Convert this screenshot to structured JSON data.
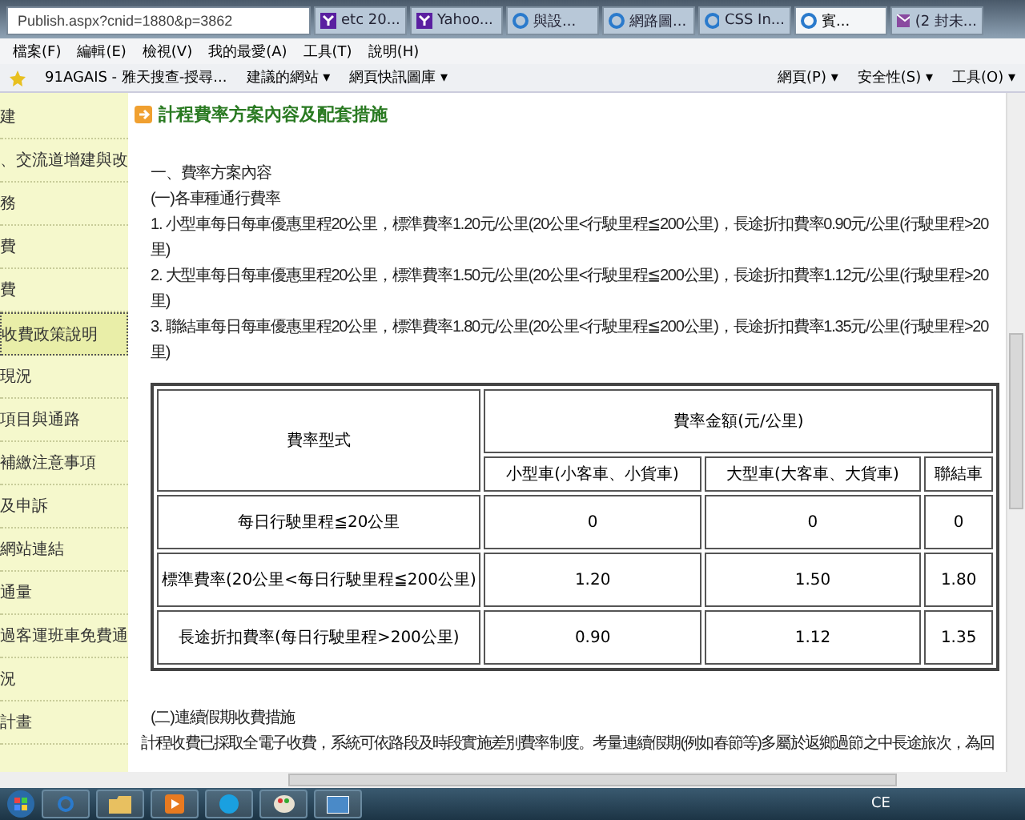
{
  "browser": {
    "address": "Publish.aspx?cnid=1880&p=3862",
    "tabs": [
      {
        "label": "etc 20...",
        "selected": false
      },
      {
        "label": "Yahoo...",
        "selected": false
      },
      {
        "label": "與設...",
        "selected": false
      },
      {
        "label": "網路圖...",
        "selected": false
      },
      {
        "label": "CSS In...",
        "selected": false
      },
      {
        "label": "賓...",
        "selected": true
      },
      {
        "label": "(2 封未...",
        "selected": false
      }
    ],
    "menu": [
      "檔案(F)",
      "編輯(E)",
      "檢視(V)",
      "我的最愛(A)",
      "工具(T)",
      "說明(H)"
    ],
    "favorites": [
      "91AGAIS - 雅天搜查-授尋...",
      "建議的網站 ▾",
      "網頁快訊圖庫 ▾"
    ],
    "commands": [
      "網頁(P) ▾",
      "安全性(S) ▾",
      "工具(O) ▾"
    ]
  },
  "sidebar": {
    "items": [
      {
        "label": "建",
        "selected": false
      },
      {
        "label": "、交流道增建與改",
        "selected": false
      },
      {
        "label": "務",
        "selected": false
      },
      {
        "label": "費",
        "selected": false
      },
      {
        "label": "費",
        "selected": false
      },
      {
        "label": "收費政策說明",
        "selected": true
      },
      {
        "label": "現況",
        "selected": false
      },
      {
        "label": "項目與通路",
        "selected": false
      },
      {
        "label": "補繳注意事項",
        "selected": false
      },
      {
        "label": "及申訴",
        "selected": false
      },
      {
        "label": "網站連結",
        "selected": false
      },
      {
        "label": "通量",
        "selected": false
      },
      {
        "label": "過客運班車免費通",
        "selected": false
      },
      {
        "label": "況",
        "selected": false
      },
      {
        "label": "計畫",
        "selected": false
      }
    ]
  },
  "article": {
    "title": "計程費率方案內容及配套措施",
    "lines": [
      "一、費率方案內容",
      "(一)各車種通行費率",
      "1. 小型車每日每車優惠里程20公里，標準費率1.20元/公里(20公里<行駛里程≦200公里)，長途折扣費率0.90元/公里(行駛里程>20",
      "里)",
      "2. 大型車每日每車優惠里程20公里，標準費率1.50元/公里(20公里<行駛里程≦200公里)，長途折扣費率1.12元/公里(行駛里程>20",
      "里)",
      "3. 聯結車每日每車優惠里程20公里，標準費率1.80元/公里(20公里<行駛里程≦200公里)，長途折扣費率1.35元/公里(行駛里程>20",
      "里)"
    ],
    "table": {
      "header_rows": [
        [
          {
            "text": "費率型式",
            "rowspan": 2
          },
          {
            "text": "費率金額(元/公里)",
            "colspan": 3
          }
        ],
        [
          {
            "text": "小型車(小客車、小貨車)"
          },
          {
            "text": "大型車(大客車、大貨車)"
          },
          {
            "text": "聯結車"
          }
        ]
      ],
      "rows": [
        [
          "每日行駛里程≦20公里",
          "0",
          "0",
          "0"
        ],
        [
          "標準費率(20公里<每日行駛里程≦200公里)",
          "1.20",
          "1.50",
          "1.80"
        ],
        [
          "長途折扣費率(每日行駛里程>200公里)",
          "0.90",
          "1.12",
          "1.35"
        ]
      ]
    },
    "section2_title": "(二)連續假期收費措施",
    "section2_text": "計程收費已採取全電子收費，系統可依路段及時段實施差別費率制度。考量連續假期(例如春節等)多屬於返鄉過節之中長途旅次，為回"
  },
  "taskbar": {
    "tray_text": "CE"
  }
}
